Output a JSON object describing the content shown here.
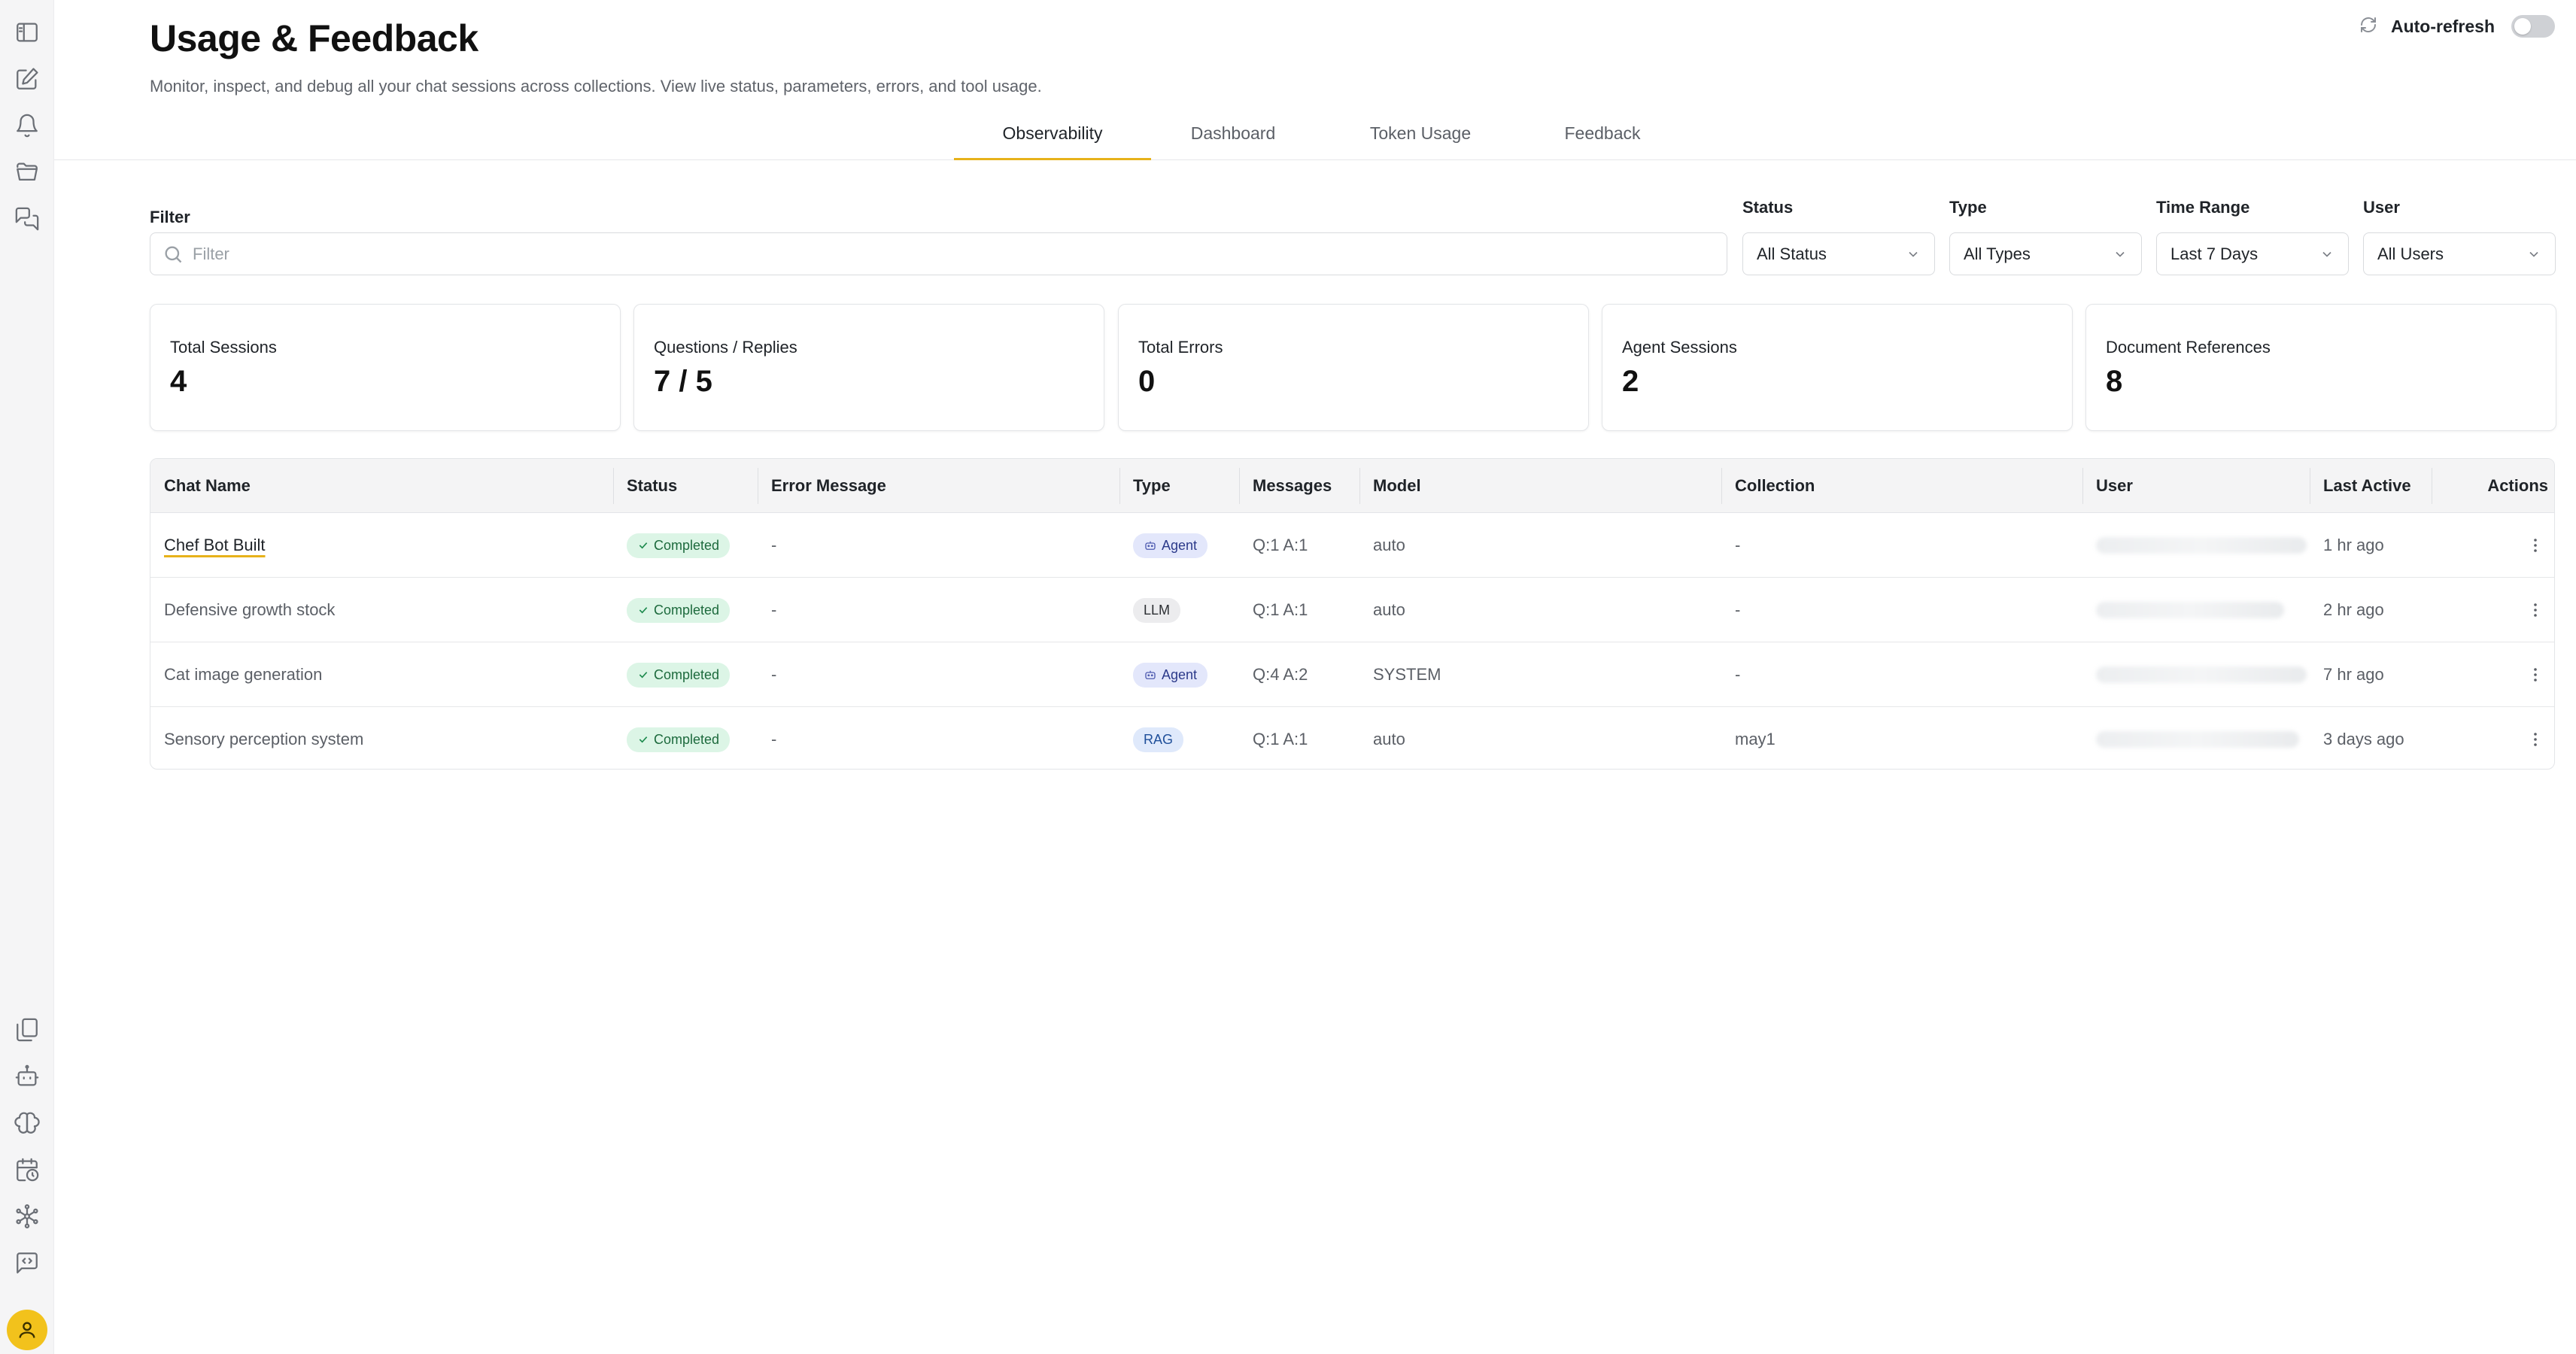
{
  "header": {
    "title": "Usage & Feedback",
    "subtitle": "Monitor, inspect, and debug all your chat sessions across collections. View live status, parameters, errors, and tool usage.",
    "auto_refresh_label": "Auto-refresh",
    "auto_refresh_on": false
  },
  "tabs": [
    {
      "label": "Observability",
      "active": true
    },
    {
      "label": "Dashboard",
      "active": false
    },
    {
      "label": "Token Usage",
      "active": false
    },
    {
      "label": "Feedback",
      "active": false
    }
  ],
  "filters": {
    "filter_label": "Filter",
    "filter_placeholder": "Filter",
    "status_label": "Status",
    "status_value": "All Status",
    "type_label": "Type",
    "type_value": "All Types",
    "time_label": "Time Range",
    "time_value": "Last 7 Days",
    "user_label": "User",
    "user_value": "All Users"
  },
  "stats": [
    {
      "label": "Total Sessions",
      "value": "4"
    },
    {
      "label": "Questions / Replies",
      "value": "7 / 5"
    },
    {
      "label": "Total Errors",
      "value": "0"
    },
    {
      "label": "Agent Sessions",
      "value": "2"
    },
    {
      "label": "Document References",
      "value": "8"
    }
  ],
  "table": {
    "columns": [
      "Chat Name",
      "Status",
      "Error Message",
      "Type",
      "Messages",
      "Model",
      "Collection",
      "User",
      "Last Active",
      "Actions"
    ],
    "rows": [
      {
        "chat_name": "Chef Bot Built",
        "status": "Completed",
        "error": "-",
        "type": "Agent",
        "messages": "Q:1 A:1",
        "model": "auto",
        "collection": "-",
        "last_active": "1 hr ago"
      },
      {
        "chat_name": "Defensive growth stock",
        "status": "Completed",
        "error": "-",
        "type": "LLM",
        "messages": "Q:1 A:1",
        "model": "auto",
        "collection": "-",
        "last_active": "2 hr ago"
      },
      {
        "chat_name": "Cat image generation",
        "status": "Completed",
        "error": "-",
        "type": "Agent",
        "messages": "Q:4 A:2",
        "model": "SYSTEM",
        "collection": "-",
        "last_active": "7 hr ago"
      },
      {
        "chat_name": "Sensory perception system",
        "status": "Completed",
        "error": "-",
        "type": "RAG",
        "messages": "Q:1 A:1",
        "model": "auto",
        "collection": "may1",
        "last_active": "3 days ago"
      }
    ]
  },
  "colors": {
    "accent": "#e7b21a",
    "completed_bg": "#dcf5e6",
    "agent_bg": "#e3e7fb"
  },
  "icons": {
    "rail_top": [
      "sidebar-toggle-icon",
      "edit-icon",
      "bell-icon",
      "folder-icon",
      "chat-bubbles-icon"
    ],
    "rail_bottom": [
      "documents-icon",
      "robot-icon",
      "brain-icon",
      "calendar-clock-icon",
      "network-icon",
      "code-message-icon"
    ]
  }
}
